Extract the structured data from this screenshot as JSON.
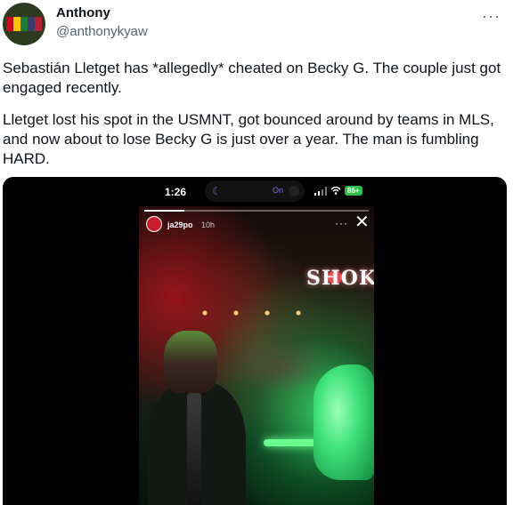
{
  "author": {
    "name": "Anthony",
    "handle": "@anthonykyaw"
  },
  "tweet": {
    "paragraph1": "Sebastián Lletget has *allegedly* cheated on Becky G. The couple just got engaged recently.",
    "paragraph2": "Lletget lost his spot in the USMNT, got bounced around by teams in MLS, and now about to lose Becky G is just over a year. The man is fumbling HARD."
  },
  "media": {
    "status_bar": {
      "time": "1:26",
      "island_label": "On",
      "battery": "86+"
    },
    "story": {
      "username": "ja29po",
      "age": "10h",
      "progress": 0.18,
      "neon_sign": "SHOKO"
    }
  },
  "icons": {
    "more": "more-horizontal-icon",
    "close": "close-icon",
    "moon": "moon-icon",
    "signal": "signal-icon",
    "wifi": "wifi-icon"
  },
  "colors": {
    "text": "#0f1419",
    "secondary_text": "#536471",
    "battery_green": "#2fbf4a",
    "neon_red": "#e0222d"
  }
}
